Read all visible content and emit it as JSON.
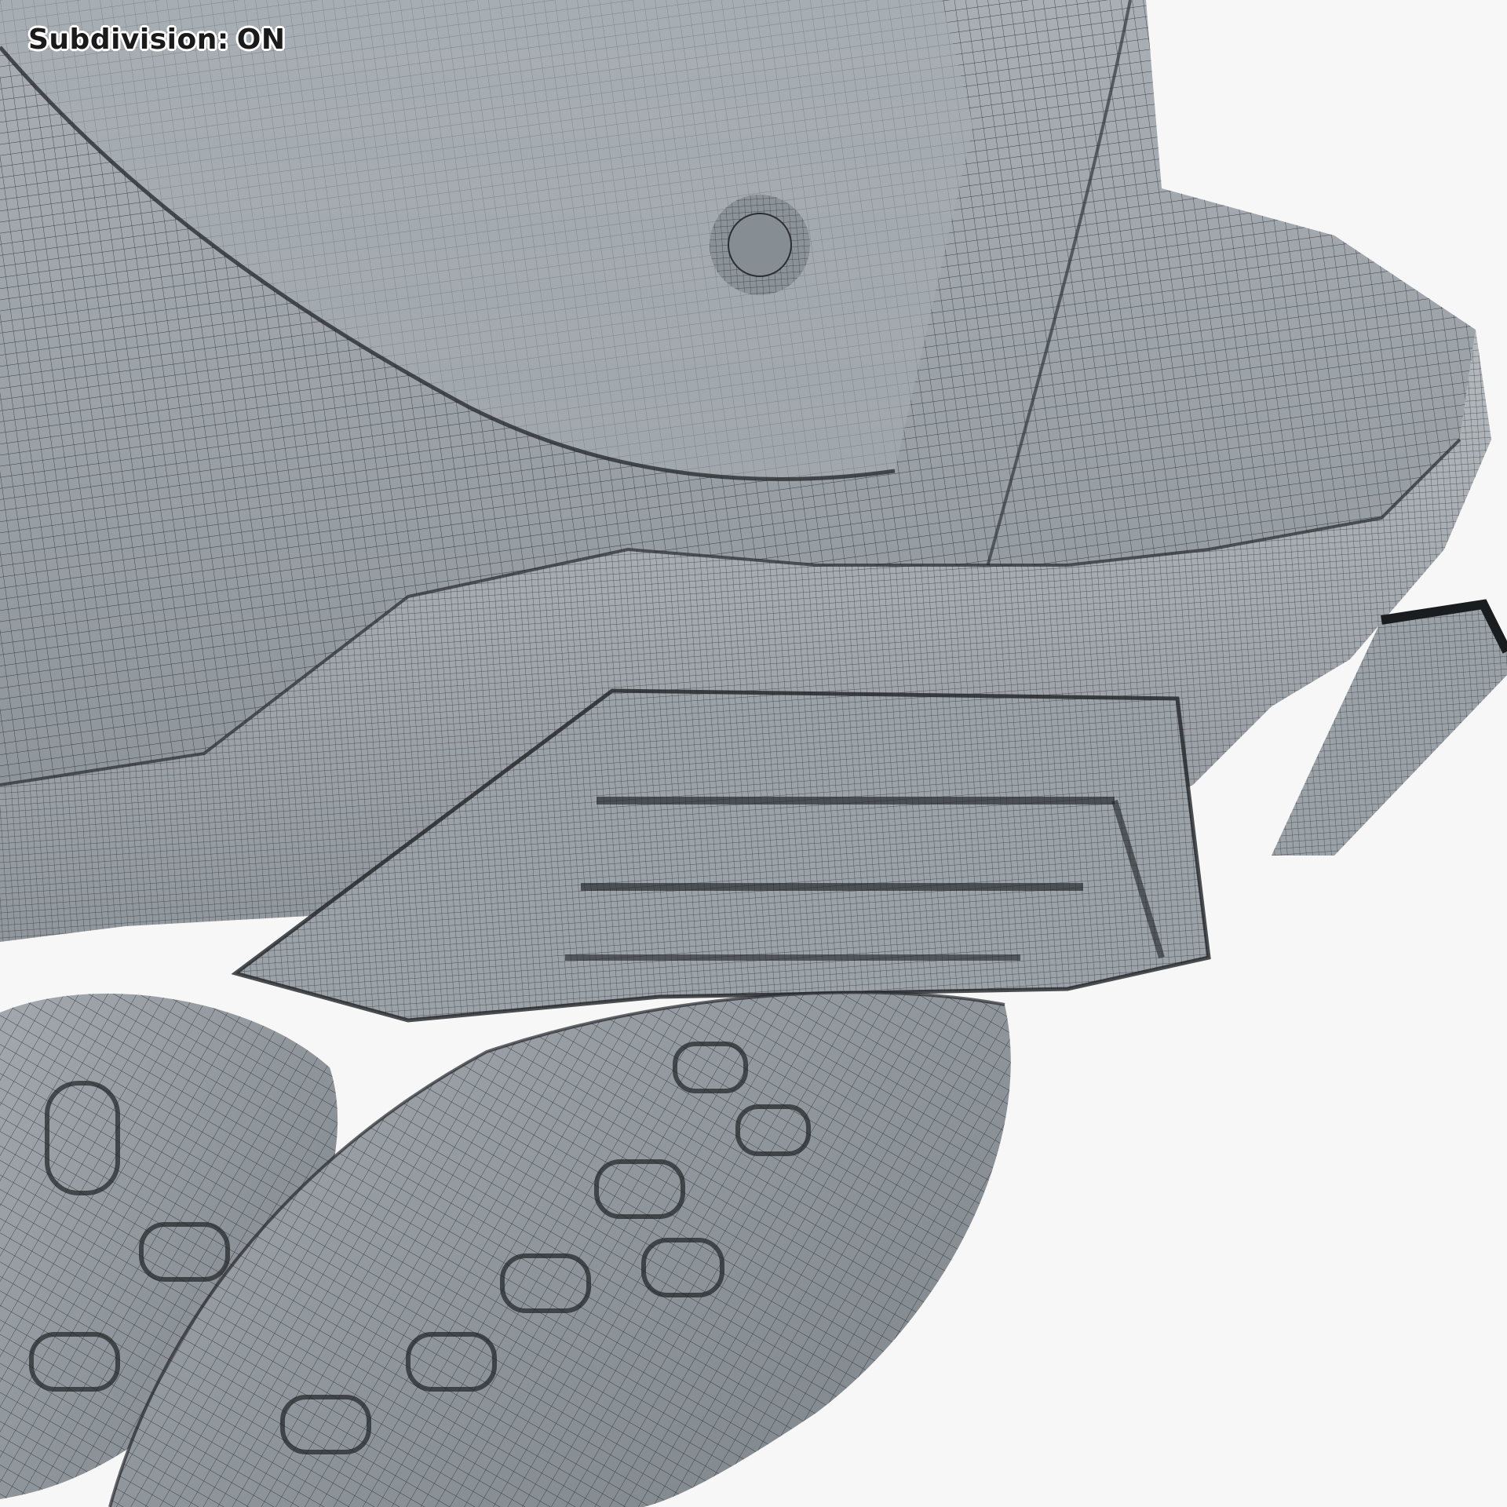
{
  "overlay": {
    "label": "Subdivision:",
    "value": "ON"
  },
  "colors": {
    "background": "#f7f7f7",
    "surface": "#9aa1a7",
    "surface_light": "#b7bcc1",
    "surface_dark": "#6e757b",
    "wire": "#2b2f33"
  }
}
